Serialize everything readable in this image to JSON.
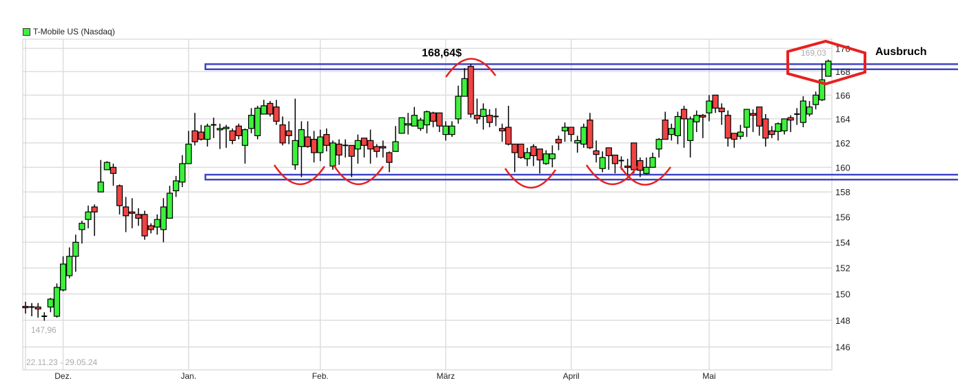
{
  "legend": {
    "label": "T-Mobile US (Nasdaq)",
    "color": "#3cf03c"
  },
  "chart_data": {
    "type": "candlestick",
    "title": "",
    "range_label": "22.11.23 - 29.05.24",
    "y_scale": "log",
    "ylim": [
      144.3,
      170.8
    ],
    "y_axis_position": "right",
    "y_ticks": [
      146,
      148,
      150,
      152,
      154,
      156,
      158,
      160,
      162,
      164,
      166,
      168,
      170
    ],
    "x_ticks": [
      {
        "label": "Dez.",
        "candle": 6
      },
      {
        "label": "Jan.",
        "candle": 26
      },
      {
        "label": "Feb.",
        "candle": 47
      },
      {
        "label": "März",
        "candle": 67
      },
      {
        "label": "April",
        "candle": 87
      },
      {
        "label": "Mai",
        "candle": 109
      }
    ],
    "grid": true,
    "colors": {
      "up": "#3cf03c",
      "down": "#f04343",
      "grid": "#dddddd",
      "zone": "#3f44c4",
      "annotation": "#e82020"
    },
    "ohlc_fields": [
      "open",
      "high",
      "low",
      "close"
    ],
    "candles": [
      [
        149.05,
        149.4,
        148.5,
        148.95
      ],
      [
        149.0,
        149.3,
        148.3,
        149.0
      ],
      [
        149.0,
        149.3,
        148.2,
        148.85
      ],
      [
        148.3,
        148.6,
        147.96,
        148.3
      ],
      [
        149.0,
        149.7,
        148.6,
        149.6
      ],
      [
        148.3,
        150.8,
        148.2,
        150.5
      ],
      [
        150.3,
        152.9,
        150.2,
        152.3
      ],
      [
        151.4,
        153.6,
        151.2,
        152.9
      ],
      [
        152.9,
        154.6,
        151.7,
        154.0
      ],
      [
        155.0,
        155.7,
        153.9,
        155.5
      ],
      [
        155.8,
        156.9,
        155.1,
        156.4
      ],
      [
        156.8,
        157.0,
        154.5,
        156.4
      ],
      [
        158.0,
        160.6,
        158.0,
        158.8
      ],
      [
        159.8,
        160.5,
        159.8,
        160.4
      ],
      [
        160.0,
        160.3,
        158.5,
        159.5
      ],
      [
        158.5,
        158.6,
        156.2,
        156.9
      ],
      [
        156.8,
        157.6,
        154.8,
        156.1
      ],
      [
        156.4,
        157.5,
        155.1,
        156.3
      ],
      [
        156.2,
        156.7,
        155.3,
        155.9
      ],
      [
        156.2,
        156.5,
        154.2,
        154.5
      ],
      [
        155.3,
        155.5,
        154.7,
        155.0
      ],
      [
        155.2,
        156.2,
        154.6,
        155.8
      ],
      [
        155.0,
        157.5,
        154.0,
        156.8
      ],
      [
        155.9,
        158.5,
        155.9,
        157.9
      ],
      [
        158.1,
        159.3,
        157.6,
        158.9
      ],
      [
        158.8,
        161.0,
        158.4,
        160.3
      ],
      [
        160.3,
        163.0,
        160.3,
        161.9
      ],
      [
        163.0,
        164.5,
        161.8,
        162.1
      ],
      [
        162.9,
        163.5,
        162.2,
        162.3
      ],
      [
        162.3,
        163.6,
        161.7,
        163.4
      ],
      [
        163.5,
        164.1,
        162.4,
        163.5
      ],
      [
        163.1,
        163.6,
        161.5,
        163.2
      ],
      [
        163.2,
        163.5,
        161.6,
        163.3
      ],
      [
        163.0,
        163.2,
        161.9,
        162.2
      ],
      [
        163.4,
        163.6,
        162.3,
        162.6
      ],
      [
        161.8,
        163.2,
        160.3,
        163.1
      ],
      [
        163.2,
        164.9,
        162.8,
        164.3
      ],
      [
        162.6,
        165.1,
        162.3,
        164.9
      ],
      [
        164.4,
        165.6,
        164.4,
        165.1
      ],
      [
        165.3,
        165.5,
        164.2,
        164.4
      ],
      [
        165.0,
        165.6,
        163.5,
        163.8
      ],
      [
        163.5,
        164.2,
        161.8,
        162.0
      ],
      [
        163.0,
        163.8,
        161.9,
        162.6
      ],
      [
        160.2,
        165.7,
        159.8,
        162.2
      ],
      [
        161.7,
        163.8,
        159.2,
        163.1
      ],
      [
        162.5,
        163.8,
        161.6,
        161.7
      ],
      [
        162.3,
        163.0,
        160.4,
        161.2
      ],
      [
        161.2,
        163.1,
        160.5,
        162.5
      ],
      [
        162.7,
        163.2,
        161.3,
        161.8
      ],
      [
        160.1,
        162.2,
        159.8,
        162.0
      ],
      [
        161.9,
        162.3,
        160.2,
        161.0
      ],
      [
        161.8,
        162.3,
        160.8,
        161.8
      ],
      [
        161.8,
        161.8,
        159.2,
        160.9
      ],
      [
        161.5,
        162.7,
        160.3,
        162.2
      ],
      [
        162.4,
        162.4,
        160.8,
        161.8
      ],
      [
        162.2,
        163.1,
        160.3,
        161.5
      ],
      [
        161.7,
        161.9,
        160.8,
        161.3
      ],
      [
        161.7,
        162.2,
        160.8,
        161.6
      ],
      [
        161.2,
        161.3,
        159.6,
        160.4
      ],
      [
        161.3,
        163.4,
        161.3,
        162.1
      ],
      [
        162.8,
        164.1,
        162.8,
        164.1
      ],
      [
        163.5,
        164.5,
        162.7,
        163.6
      ],
      [
        163.4,
        165.0,
        163.4,
        164.3
      ],
      [
        163.2,
        164.1,
        163.0,
        163.9
      ],
      [
        163.5,
        164.7,
        162.8,
        164.6
      ],
      [
        164.5,
        164.6,
        163.3,
        163.8
      ],
      [
        164.5,
        164.5,
        162.9,
        163.4
      ],
      [
        162.7,
        163.8,
        162.2,
        163.4
      ],
      [
        162.7,
        163.8,
        162.5,
        163.4
      ],
      [
        164.0,
        166.8,
        163.6,
        165.9
      ],
      [
        165.9,
        168.3,
        165.9,
        167.4
      ],
      [
        168.45,
        168.64,
        164.1,
        164.4
      ],
      [
        164.3,
        165.7,
        163.6,
        164.0
      ],
      [
        164.2,
        165.3,
        163.1,
        164.8
      ],
      [
        164.3,
        164.8,
        163.3,
        163.7
      ],
      [
        164.2,
        164.9,
        163.4,
        164.2
      ],
      [
        163.2,
        163.6,
        162.1,
        163.0
      ],
      [
        163.3,
        165.1,
        161.8,
        161.9
      ],
      [
        161.9,
        161.9,
        159.6,
        161.2
      ],
      [
        161.9,
        161.9,
        160.7,
        160.8
      ],
      [
        160.7,
        161.6,
        160.1,
        161.2
      ],
      [
        161.7,
        161.9,
        160.1,
        160.95
      ],
      [
        161.5,
        161.5,
        159.5,
        160.6
      ],
      [
        160.3,
        161.4,
        160.2,
        161.1
      ],
      [
        160.7,
        161.8,
        160.0,
        161.1
      ],
      [
        162.3,
        162.6,
        161.4,
        162.0
      ],
      [
        163.0,
        163.7,
        162.1,
        163.3
      ],
      [
        163.3,
        163.3,
        162.1,
        162.7
      ],
      [
        162.0,
        162.6,
        161.2,
        162.2
      ],
      [
        161.9,
        163.6,
        161.6,
        163.3
      ],
      [
        163.9,
        164.5,
        161.5,
        161.6
      ],
      [
        161.35,
        162.2,
        160.4,
        161.05
      ],
      [
        159.9,
        161.3,
        159.6,
        160.8
      ],
      [
        161.6,
        161.6,
        159.8,
        160.95
      ],
      [
        161.0,
        161.0,
        159.5,
        160.3
      ],
      [
        160.55,
        160.9,
        159.8,
        160.55
      ],
      [
        160.1,
        160.7,
        159.4,
        160.0
      ],
      [
        162.0,
        162.0,
        159.5,
        159.8
      ],
      [
        160.55,
        160.8,
        159.2,
        159.75
      ],
      [
        159.5,
        160.8,
        159.4,
        160.0
      ],
      [
        160.0,
        161.2,
        160.0,
        160.8
      ],
      [
        161.5,
        162.4,
        160.8,
        162.3
      ],
      [
        163.9,
        164.6,
        162.3,
        162.3
      ],
      [
        162.7,
        163.6,
        162.2,
        163.2
      ],
      [
        162.6,
        164.6,
        161.9,
        164.2
      ],
      [
        164.8,
        165.1,
        161.6,
        164.0
      ],
      [
        162.2,
        164.2,
        160.8,
        164.0
      ],
      [
        163.75,
        164.7,
        162.9,
        164.3
      ],
      [
        164.3,
        164.4,
        162.4,
        164.15
      ],
      [
        164.5,
        166.0,
        163.8,
        165.5
      ],
      [
        166.0,
        166.0,
        164.5,
        164.9
      ],
      [
        164.9,
        165.3,
        163.5,
        164.6
      ],
      [
        164.3,
        164.7,
        161.7,
        162.4
      ],
      [
        162.8,
        162.8,
        161.6,
        162.3
      ],
      [
        162.55,
        163.5,
        162.3,
        162.9
      ],
      [
        163.3,
        164.8,
        162.5,
        164.8
      ],
      [
        164.45,
        164.8,
        162.9,
        164.3
      ],
      [
        165.0,
        165.0,
        162.6,
        163.4
      ],
      [
        164.0,
        164.4,
        161.7,
        162.4
      ],
      [
        163.0,
        163.4,
        162.4,
        162.7
      ],
      [
        162.95,
        163.7,
        162.2,
        163.6
      ],
      [
        163.0,
        164.0,
        162.7,
        164.0
      ],
      [
        164.1,
        164.3,
        162.9,
        163.9
      ],
      [
        164.4,
        164.9,
        163.5,
        164.4
      ],
      [
        163.7,
        165.9,
        163.3,
        165.5
      ],
      [
        164.4,
        165.5,
        164.2,
        165.0
      ],
      [
        165.2,
        166.3,
        164.8,
        166.0
      ],
      [
        165.6,
        168.7,
        165.5,
        167.3
      ],
      [
        167.6,
        169.03,
        167.6,
        168.9
      ]
    ],
    "low_label": "147,96",
    "high_label": "169,03",
    "annotations": {
      "peak_label": "168,64$",
      "breakout_label": "Ausbruch",
      "resistance_zone": [
        168.2,
        168.64
      ],
      "support_zone": [
        159.0,
        159.4
      ]
    }
  }
}
